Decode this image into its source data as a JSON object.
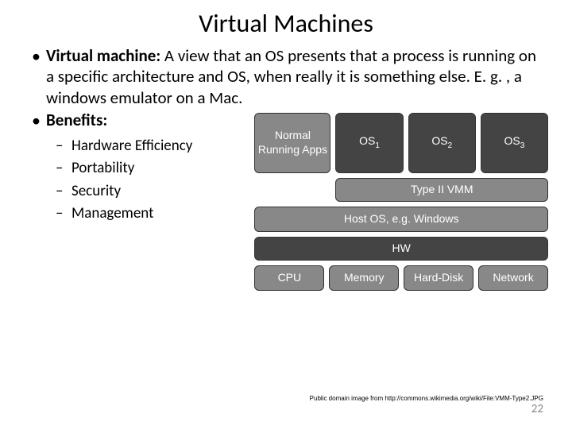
{
  "title": "Virtual Machines",
  "definition_label": "Virtual machine:",
  "definition_text": " A view that an OS presents that a process is running on a specific architecture and OS, when really it is something else. E. g. , a windows emulator on a Mac.",
  "benefits_label": "Benefits:",
  "benefits_items": [
    "Hardware Efficiency",
    "Portability",
    "Security",
    "Management"
  ],
  "diagram": {
    "normal_apps": "Normal Running Apps",
    "os1": "OS",
    "os1_sub": "1",
    "os2": "OS",
    "os2_sub": "2",
    "os3": "OS",
    "os3_sub": "3",
    "vmm": "Type II VMM",
    "host_os": "Host OS, e.g. Windows",
    "hw": "HW",
    "cpu": "CPU",
    "memory": "Memory",
    "harddisk": "Hard-Disk",
    "network": "Network"
  },
  "credit": "Public domain image from http://commons.wikimedia.org/wiki/File:VMM-Type2.JPG",
  "page_number": "22"
}
